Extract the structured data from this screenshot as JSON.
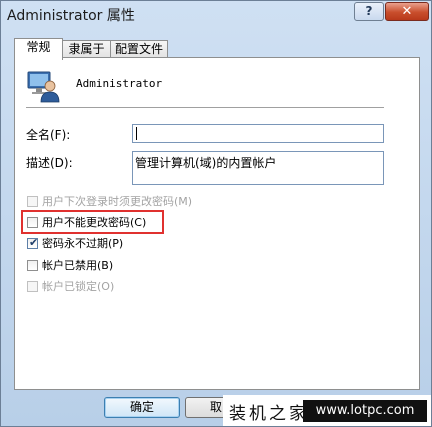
{
  "window": {
    "title": "Administrator 属性",
    "help_label": "?",
    "close_label": "✕"
  },
  "tabs": [
    {
      "label": "常规",
      "active": true
    },
    {
      "label": "隶属于",
      "active": false
    },
    {
      "label": "配置文件",
      "active": false
    }
  ],
  "user": {
    "icon": "user-computer-icon",
    "name": "Administrator"
  },
  "fields": {
    "fullname_label": "全名(F):",
    "fullname_value": "",
    "description_label": "描述(D):",
    "description_value": "管理计算机(域)的内置帐户"
  },
  "checkboxes": [
    {
      "label": "用户下次登录时须更改密码(M)",
      "checked": false,
      "enabled": false
    },
    {
      "label": "用户不能更改密码(C)",
      "checked": false,
      "enabled": true,
      "highlighted": true
    },
    {
      "label": "密码永不过期(P)",
      "checked": true,
      "enabled": true
    },
    {
      "label": "帐户已禁用(B)",
      "checked": false,
      "enabled": true
    },
    {
      "label": "帐户已锁定(O)",
      "checked": false,
      "enabled": false
    }
  ],
  "buttons": {
    "ok": "确定",
    "cancel": "取"
  },
  "watermark": {
    "left": "装机之家",
    "right": "www.lotpc.com"
  },
  "colors": {
    "highlight_border": "#e0312f",
    "close_button": "#c94e2c"
  }
}
